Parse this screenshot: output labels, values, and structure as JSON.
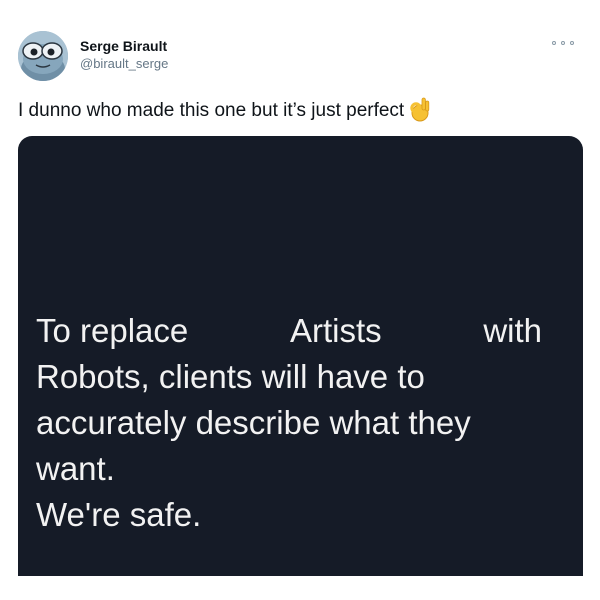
{
  "tweet": {
    "display_name": "Serge Birault",
    "handle": "@birault_serge",
    "text": "I dunno who made this one but it’s just perfect",
    "emoji": "ok-hand-emoji"
  },
  "media": {
    "line1": [
      "To replace",
      "Artists",
      "with"
    ],
    "line2": "Robots, clients will have to",
    "line3": "accurately describe what they",
    "line4": "want.",
    "line5": "We're safe."
  },
  "colors": {
    "media_background": "#151b27",
    "text_primary": "#0f1419",
    "text_secondary": "#657786"
  }
}
